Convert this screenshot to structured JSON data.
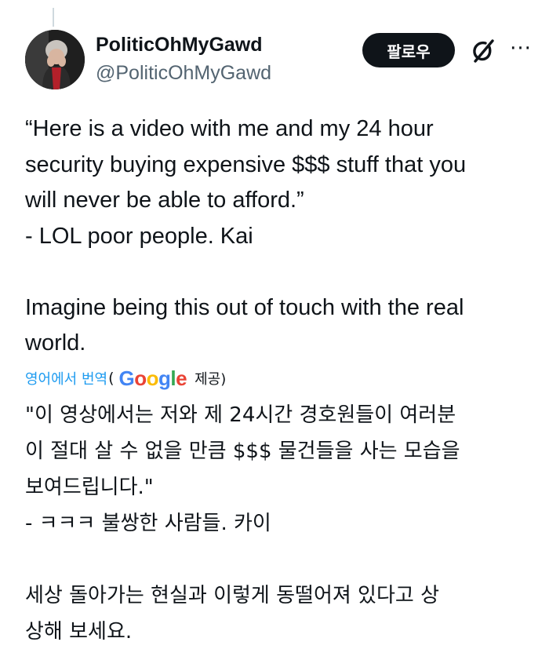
{
  "author": {
    "display_name": "PoliticOhMyGawd",
    "handle": "@PoliticOhMyGawd"
  },
  "actions": {
    "follow_label": "팔로우",
    "grok_icon": "grok-slash-icon",
    "more_icon": "more-dots-icon",
    "more_glyph": "···"
  },
  "post": {
    "text": "“Here is a video with me and my 24 hour\nsecurity buying expensive $$$ stuff that you\nwill never be able to afford.”\n          - LOL poor people. Kai\n\nImagine being this out of touch with the real\nworld."
  },
  "translation": {
    "link_label": "영어에서 번역",
    "open_paren": "(",
    "provider": "Google",
    "provided_label": "제공)",
    "text": "\"이 영상에서는 저와 제 24시간 경호원들이 여러분\n이 절대 살 수 없을 만큼 $$$ 물건들을 사는 모습을\n보여드립니다.\"\n- ㅋㅋㅋ 불쌍한 사람들. 카이\n\n세상 돌아가는 현실과 이렇게 동떨어져 있다고 상\n상해 보세요."
  },
  "colors": {
    "link": "#1d9bf0",
    "text": "#0f1419",
    "secondary": "#536471",
    "button_bg": "#0f1419",
    "google_blue": "#4285F4",
    "google_red": "#EA4335",
    "google_yellow": "#FBBC05",
    "google_green": "#34A853"
  }
}
